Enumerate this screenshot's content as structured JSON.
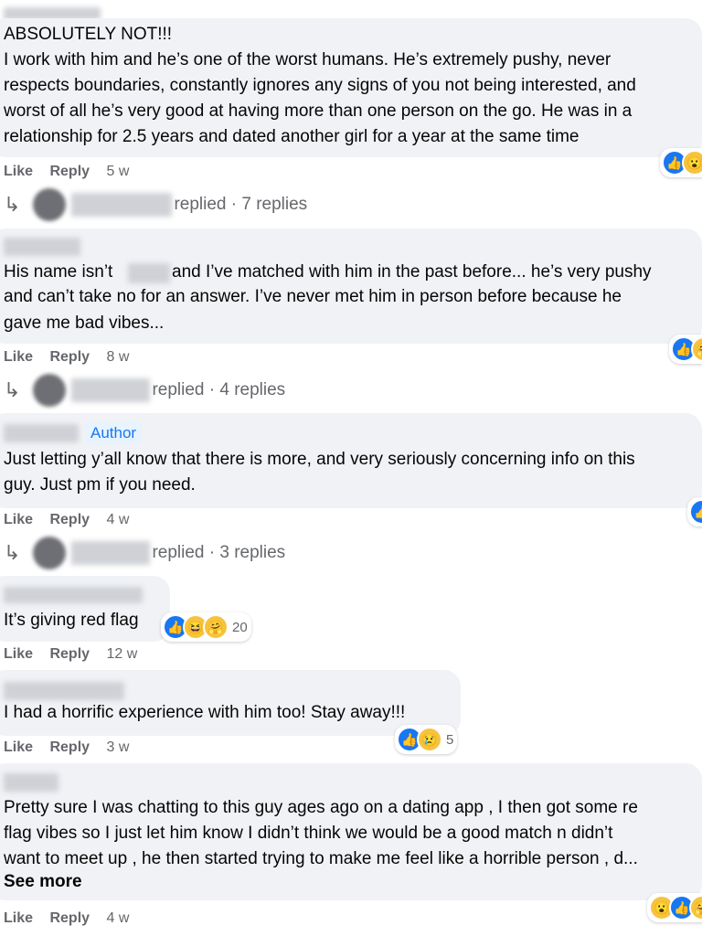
{
  "comments": [
    {
      "lines": [
        "ABSOLUTELY NOT!!!",
        "I work with him and he’s one of the worst humans. He’s extremely pushy, never",
        "respects boundaries, constantly ignores any signs of you not being interested, and",
        "worst of all he’s very good at having more than one person on the go. He was in a",
        "relationship for 2.5 years and dated another girl for a year at the same time"
      ],
      "like": "Like",
      "reply": "Reply",
      "time": "5 w",
      "replies": "replied · 7 replies"
    },
    {
      "lines": [
        "His name isn’t",
        "and I’ve matched with him in the past before... he’s very pushy",
        "and can’t take no for an answer. I’ve never met him in person before because he",
        "gave me bad vibes..."
      ],
      "like": "Like",
      "reply": "Reply",
      "time": "8 w",
      "replies": "replied · 4 replies"
    },
    {
      "badge": "Author",
      "lines": [
        "Just letting y’all know that there is more, and very seriously concerning info on this",
        "guy. Just pm if you need."
      ],
      "like": "Like",
      "reply": "Reply",
      "time": "4 w",
      "replies": "replied · 3 replies"
    },
    {
      "lines": [
        "It’s giving red flag"
      ],
      "reaction_count": "20",
      "like": "Like",
      "reply": "Reply",
      "time": "12 w"
    },
    {
      "lines": [
        "I had a horrific experience with him too! Stay away!!!"
      ],
      "reaction_count": "5",
      "like": "Like",
      "reply": "Reply",
      "time": "3 w"
    },
    {
      "lines": [
        "Pretty sure I was chatting to this guy ages ago on a dating app , I then got some re",
        "flag vibes so I just let him know I didn’t think we would be a good match n didn’t",
        "want to meet up , he then started trying to make me feel like a horrible person , d..."
      ],
      "see_more": "See more",
      "like": "Like",
      "reply": "Reply",
      "time": "4 w"
    }
  ],
  "icons": {
    "like": "like-icon",
    "wow": "wow-icon",
    "haha": "haha-icon",
    "sad": "sad-icon",
    "care": "care-icon",
    "reply_arrow": "reply-arrow-icon"
  },
  "colors": {
    "bubble": "#f0f2f5",
    "meta_text": "#65676b",
    "like_blue": "#1877f2",
    "author_bg": "#e7f3ff"
  }
}
